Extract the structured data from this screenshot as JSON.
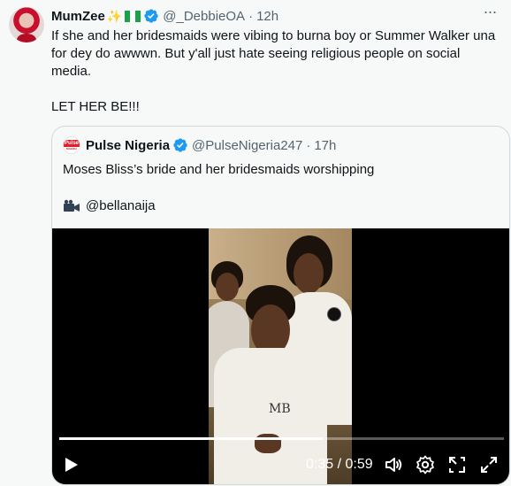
{
  "tweet": {
    "author_name": "MumZee",
    "author_emoji": "✨",
    "handle": "@_DebbieOA",
    "separator": "·",
    "time": "12h",
    "more_label": "···",
    "text": "If she and her bridesmaids were vibing to burna boy or Summer Walker una for dey do awwwn. But y'all just hate seeing religious people on social media.\n\nLET HER BE!!!"
  },
  "quote": {
    "logo_text": "Pulse",
    "logo_subtext": "NIGERIA",
    "author_name": "Pulse Nigeria",
    "handle": "@PulseNigeria247",
    "separator": "·",
    "time": "17h",
    "text": "Moses Bliss’s bride and her bridesmaids worshipping",
    "credit_icon": "camera-icon",
    "credit": "@bellanaija"
  },
  "video": {
    "watermark": "MB",
    "progress": 0.593,
    "current_time": "0:35",
    "duration": "0:59",
    "timecode": "0:35 / 0:59"
  },
  "colors": {
    "verified": "#1d9bf0",
    "secondary_text": "#536471",
    "border": "#cfd9de",
    "background": "#f7f9f9",
    "pulse_red": "#e01e2a"
  }
}
